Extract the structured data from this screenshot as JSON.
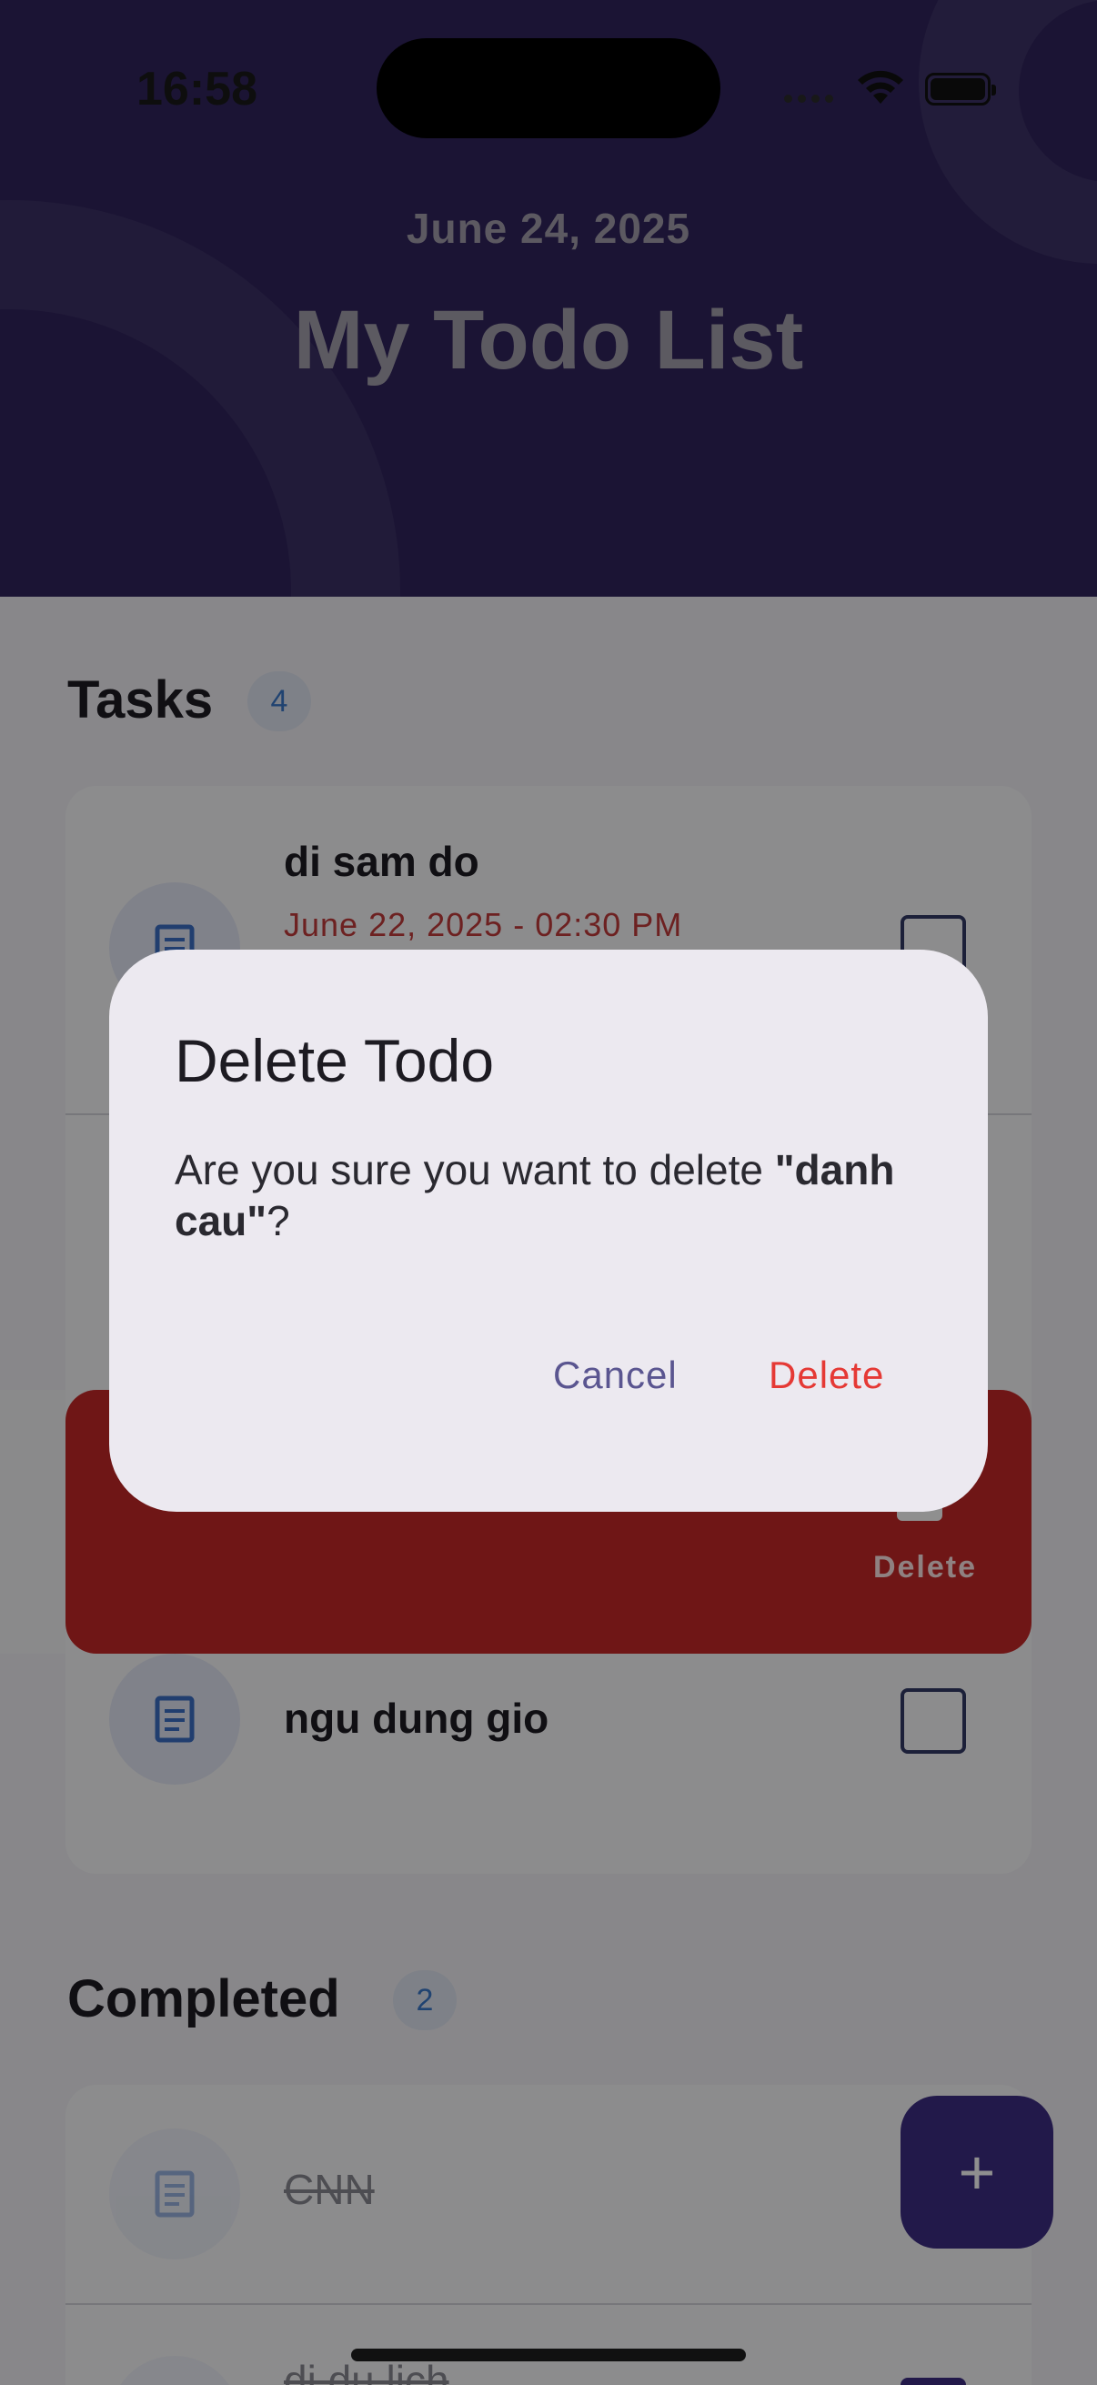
{
  "status_bar": {
    "time": "16:58"
  },
  "header": {
    "date": "June 24, 2025",
    "title": "My Todo List"
  },
  "tasks": {
    "title": "Tasks",
    "count": "4",
    "items": [
      {
        "name": "di sam do",
        "due": "June 22, 2025 - 02:30 PM",
        "checked": false
      },
      {
        "name": "danh cau",
        "checked": false,
        "swiped": true
      },
      {
        "name": "ngu dung gio",
        "checked": false
      }
    ],
    "swipe_action_label": "Delete"
  },
  "completed": {
    "title": "Completed",
    "count": "2",
    "items": [
      {
        "name": "CNN",
        "checked": true
      },
      {
        "name": "di du lich",
        "checked": true
      }
    ]
  },
  "fab": {
    "label": "+"
  },
  "dialog": {
    "title": "Delete Todo",
    "message_prefix": "Are you sure you want to delete ",
    "message_item": "\"danh cau\"",
    "message_suffix": "?",
    "cancel_label": "Cancel",
    "delete_label": "Delete"
  },
  "colors": {
    "header_bg": "#30245d",
    "accent": "#3d2d85",
    "danger": "#c62828",
    "due": "#c23b3b"
  },
  "icons": {
    "task": "note-icon",
    "add": "plus-icon",
    "wifi": "wifi-icon",
    "battery": "battery-icon"
  }
}
